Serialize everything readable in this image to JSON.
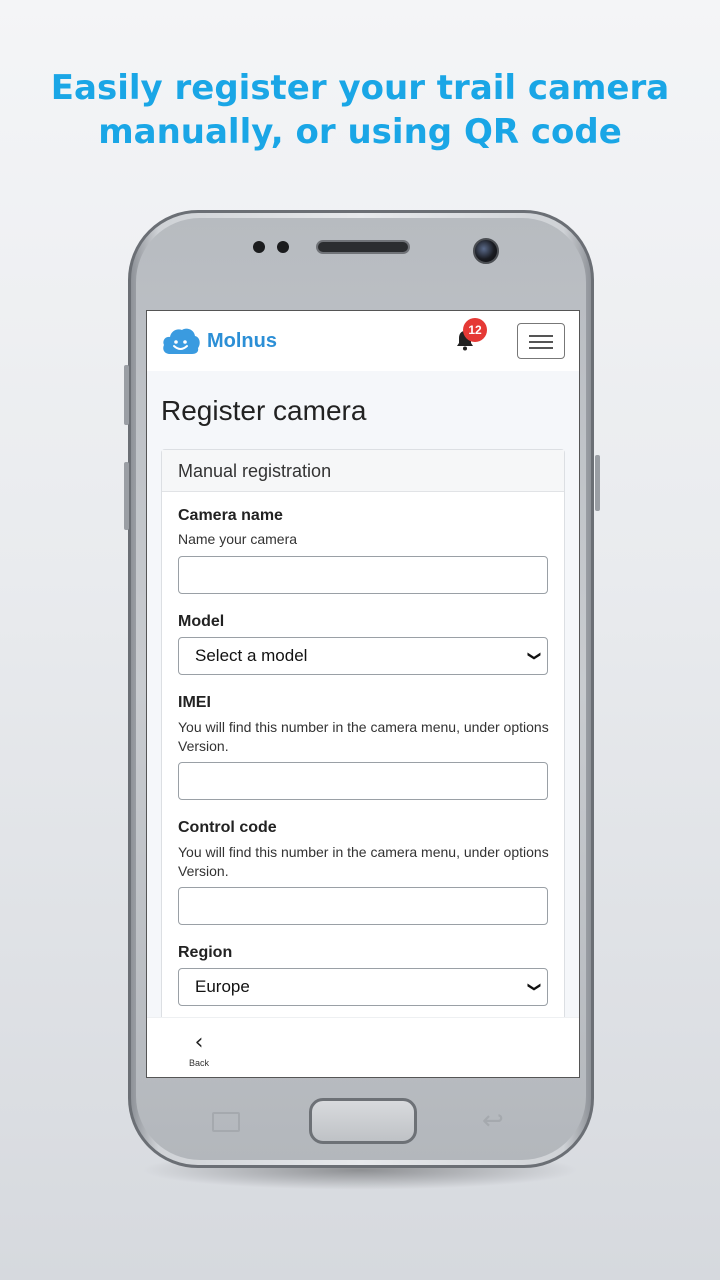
{
  "headline": {
    "line1": "Easily register your trail camera",
    "line2": "manually, or using QR code",
    "color": "#1aa6e6"
  },
  "navbar": {
    "brand": "Molnus",
    "brand_color": "#2c8fd6",
    "notification_count": "12",
    "bell_icon": "bell-icon",
    "menu_icon": "hamburger-icon"
  },
  "page": {
    "title": "Register camera"
  },
  "form": {
    "section_title": "Manual registration",
    "camera_name": {
      "label": "Camera name",
      "help": "Name your camera",
      "value": ""
    },
    "model": {
      "label": "Model",
      "selected": "Select a model"
    },
    "imei": {
      "label": "IMEI",
      "help": "You will find this number in the camera menu, under options Version.",
      "value": ""
    },
    "control_code": {
      "label": "Control code",
      "help": "You will find this number in the camera menu, under options Version.",
      "value": ""
    },
    "region": {
      "label": "Region",
      "selected": "Europe"
    }
  },
  "bottom_nav": {
    "back_label": "Back",
    "back_icon": "chevron-left-icon"
  }
}
